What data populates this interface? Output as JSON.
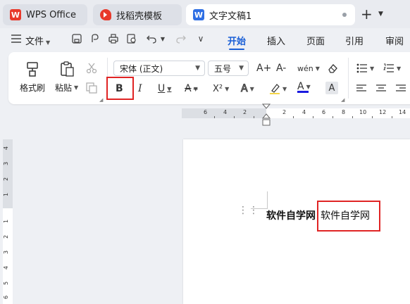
{
  "tabs": [
    {
      "label": "WPS Office",
      "logo": "W"
    },
    {
      "label": "找稻壳模板",
      "logo": "D"
    },
    {
      "label": "文字文稿1",
      "logo": "W"
    }
  ],
  "menu": {
    "file_label": "文件",
    "items": [
      "开始",
      "插入",
      "页面",
      "引用",
      "审阅"
    ],
    "active_item": "开始"
  },
  "ribbon": {
    "format_painter": "格式刷",
    "paste": "粘贴",
    "font_name": "宋体 (正文)",
    "font_size": "五号",
    "bold": "B",
    "italic": "I",
    "underline": "U",
    "strike": "A",
    "superscript": "X²",
    "text_effect": "A",
    "font_color": "A",
    "char_shading": "A",
    "phonetic": "wén",
    "grow_font": "A+",
    "shrink_font": "A-"
  },
  "ruler": {
    "left_numbers": [
      "6",
      "4",
      "2"
    ],
    "right_numbers": [
      "2",
      "4",
      "6",
      "8",
      "10",
      "12",
      "14"
    ]
  },
  "vruler": {
    "top_numbers": [
      "4",
      "3",
      "2",
      "1"
    ],
    "bottom_numbers": [
      "1",
      "2",
      "3",
      "4",
      "5",
      "6"
    ]
  },
  "document": {
    "bold_text": "软件自学网",
    "normal_text": "软件自学网"
  },
  "colors": {
    "accent": "#1a5fd6",
    "highlight_box": "#e02424",
    "wps_red": "#e8392b",
    "daoke_red": "#e8392b",
    "writer_blue": "#2f6fe4"
  }
}
